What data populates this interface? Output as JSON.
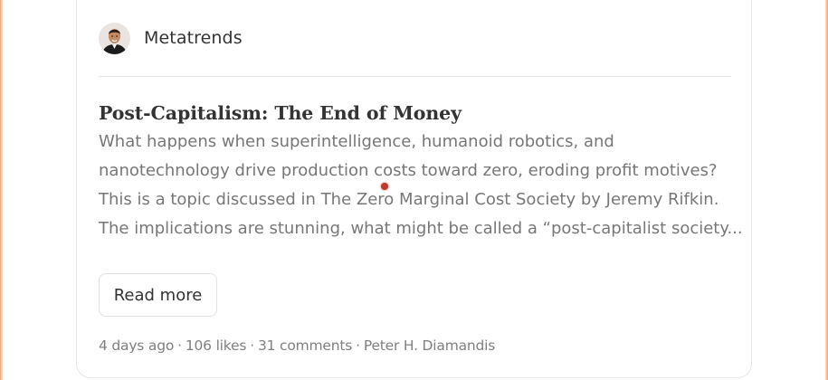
{
  "publication": {
    "name": "Metatrends",
    "avatar_icon": "author-portrait"
  },
  "post": {
    "title": "Post-Capitalism: The End of Money",
    "excerpt_lines": [
      "What happens when superintelligence, humanoid robotics, and",
      "nanotechnology drive production costs toward zero, eroding profit motives?",
      "This is a topic discussed in The Zero Marginal Cost Society by Jeremy Rifkin.",
      "The implications are stunning, what might be called a “post-capitalist society..."
    ],
    "read_more_label": "Read more",
    "meta": {
      "age": "4 days ago",
      "likes": "106 likes",
      "comments": "31 comments",
      "author": "Peter H. Diamandis",
      "separator": "·"
    }
  },
  "colors": {
    "frame_accent": "#f2a36b",
    "text_primary": "#333333",
    "text_muted": "#777777",
    "cursor": "#c0392b"
  }
}
